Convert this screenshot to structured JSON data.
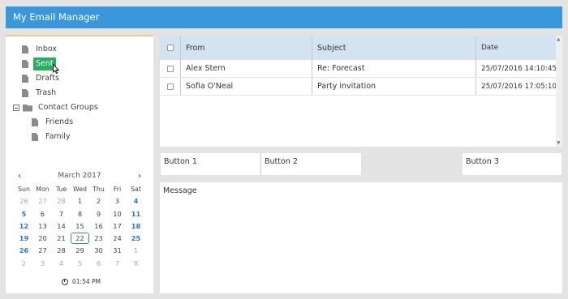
{
  "app": {
    "title": "My Email Manager"
  },
  "tree": {
    "inbox": "Inbox",
    "sent": "Sent",
    "drafts": "Drafts",
    "trash": "Trash",
    "contact_groups": "Contact Groups",
    "friends": "Friends",
    "family": "Family"
  },
  "calendar": {
    "month": "March 2017",
    "prev": "‹",
    "next": "›",
    "weekdays": [
      "Sun",
      "Mon",
      "Tue",
      "Wed",
      "Thu",
      "Fri",
      "Sat"
    ],
    "weeks": [
      [
        "26",
        "27",
        "28",
        "1",
        "2",
        "3",
        "4"
      ],
      [
        "5",
        "6",
        "7",
        "8",
        "9",
        "10",
        "11"
      ],
      [
        "12",
        "13",
        "14",
        "15",
        "16",
        "17",
        "18"
      ],
      [
        "19",
        "20",
        "21",
        "22",
        "23",
        "24",
        "25"
      ],
      [
        "26",
        "27",
        "28",
        "29",
        "30",
        "31",
        "1"
      ],
      [
        "2",
        "3",
        "4",
        "5",
        "6",
        "7",
        "8"
      ]
    ],
    "selected_day": "22",
    "time": "01:54 PM"
  },
  "grid": {
    "columns": {
      "from": "From",
      "subject": "Subject",
      "date": "Date"
    },
    "rows": [
      {
        "from": "Alex Stern",
        "subject": "Re: Forecast",
        "date": "25/07/2016 14:10:45"
      },
      {
        "from": "Sofia O'Neal",
        "subject": "Party invitation",
        "date": "25/07/2016 17:05:10"
      }
    ]
  },
  "buttons": {
    "b1": "Button 1",
    "b2": "Button 2",
    "b3": "Button 3"
  },
  "message": {
    "label": "Message"
  }
}
